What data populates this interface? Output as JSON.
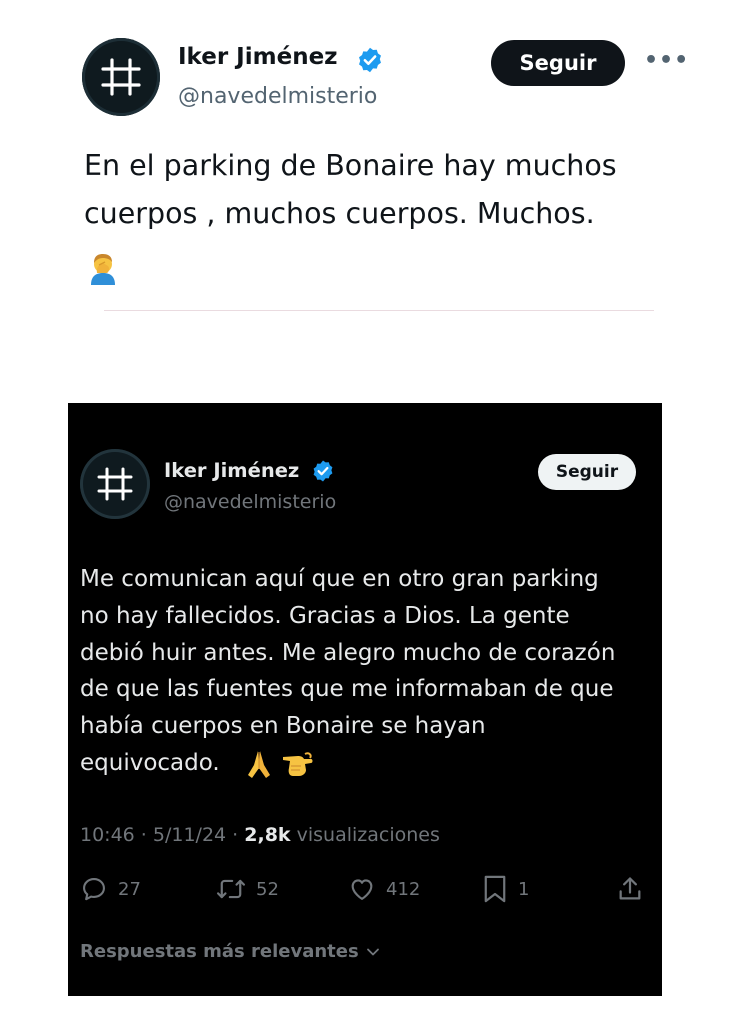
{
  "tweet_light": {
    "display_name": "Iker Jiménez",
    "handle": "@navedelmisterio",
    "follow_label": "Seguir",
    "more_label": "•••",
    "text": "En el parking de Bonaire hay muchos\ncuerpos , muchos cuerpos. Muchos.",
    "emoji": "person-facepalming-icon",
    "colors": {
      "text": "#0f1419",
      "secondary": "#536471",
      "badge": "#1d9bf0"
    }
  },
  "tweet_dark": {
    "display_name": "Iker Jiménez",
    "handle": "@navedelmisterio",
    "follow_label": "Seguir",
    "text": "Me comunican aquí que en otro gran parking\nno hay fallecidos. Gracias a Dios. La gente\ndebió huir antes. Me alegro mucho de corazón\nde que las fuentes que me informaban de que\nhabía cuerpos en Bonaire se hayan\nequivocado.",
    "emojis": [
      "folded-hands-icon",
      "pointing-hand-icon"
    ],
    "meta": {
      "time": "10:46",
      "sep1": " · ",
      "date": "5/11/24",
      "sep2": " · ",
      "views": "2,8k",
      "views_label": " visualizaciones"
    },
    "actions": {
      "replies": "27",
      "reposts": "52",
      "likes": "412",
      "bookmarks": "1"
    },
    "relevant_label": "Respuestas más relevantes",
    "colors": {
      "background": "#000000",
      "text": "#e7e9ea",
      "secondary": "#71767b",
      "badge": "#1d9bf0"
    }
  }
}
